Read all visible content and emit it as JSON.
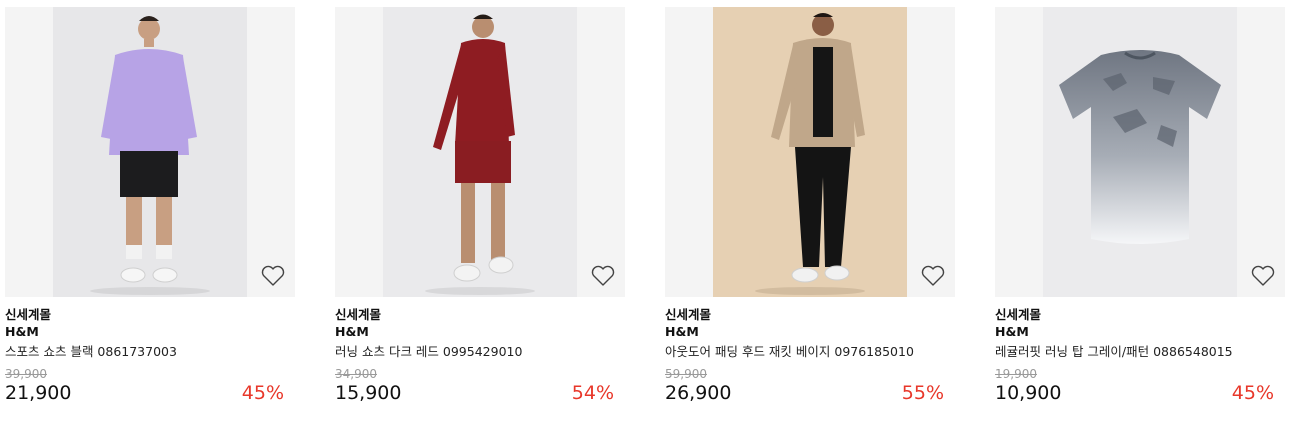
{
  "colors": {
    "discount": "#e8372a",
    "original_price": "#9a9a9a",
    "thumb_bg": "#f4f4f4"
  },
  "products": [
    {
      "mall": "신세계몰",
      "brand": "H&M",
      "name": "스포츠 쇼츠 블랙 0861737003",
      "original_price": "39,900",
      "price": "21,900",
      "discount": "45%",
      "wish_icon": "heart-outline-icon"
    },
    {
      "mall": "신세계몰",
      "brand": "H&M",
      "name": "러닝 쇼츠 다크 레드 0995429010",
      "original_price": "34,900",
      "price": "15,900",
      "discount": "54%",
      "wish_icon": "heart-outline-icon"
    },
    {
      "mall": "신세계몰",
      "brand": "H&M",
      "name": "아웃도어 패딩 후드 재킷 베이지 0976185010",
      "original_price": "59,900",
      "price": "26,900",
      "discount": "55%",
      "wish_icon": "heart-outline-icon"
    },
    {
      "mall": "신세계몰",
      "brand": "H&M",
      "name": "레귤러핏 러닝 탑 그레이/패턴 0886548015",
      "original_price": "19,900",
      "price": "10,900",
      "discount": "45%",
      "wish_icon": "heart-outline-icon"
    }
  ]
}
